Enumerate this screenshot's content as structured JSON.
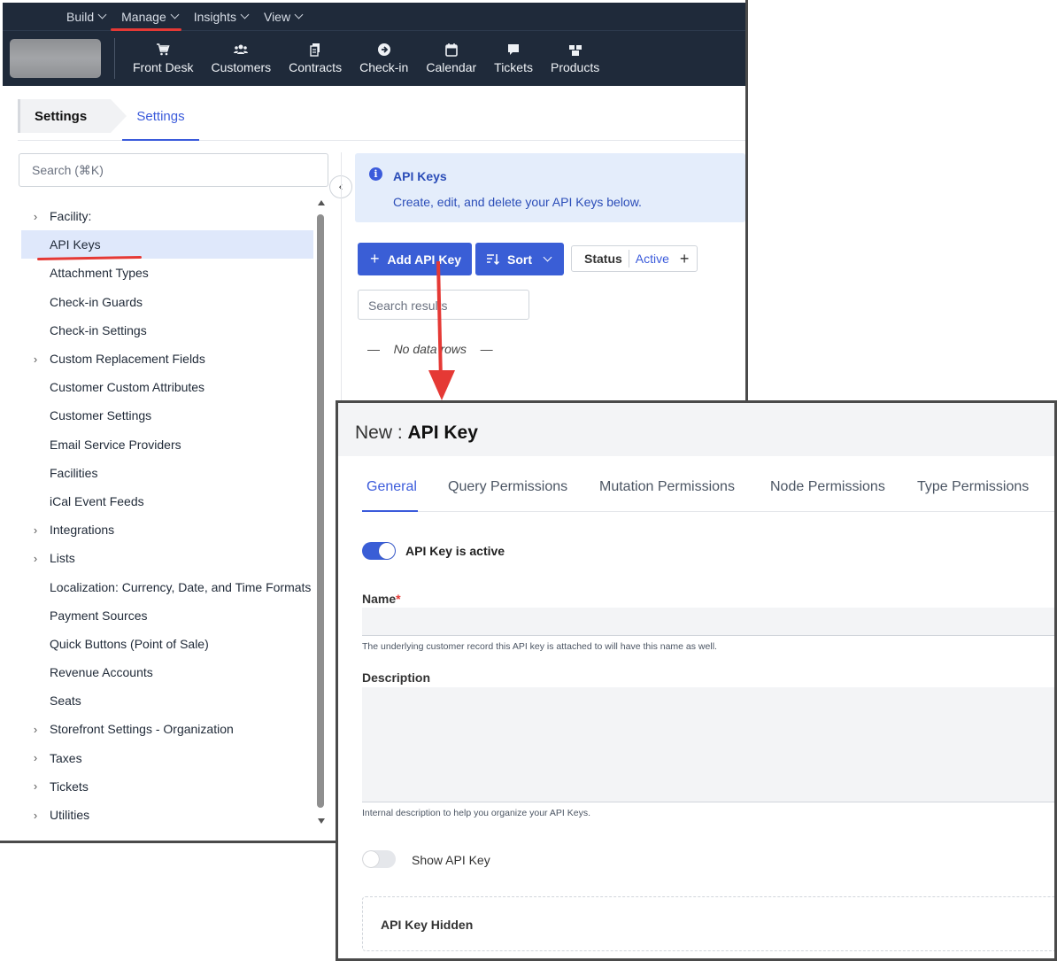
{
  "topmenu": {
    "items": [
      "Build",
      "Manage",
      "Insights",
      "View"
    ]
  },
  "navbar": {
    "items": [
      {
        "label": "Front Desk",
        "icon": "cart-icon"
      },
      {
        "label": "Customers",
        "icon": "users-icon"
      },
      {
        "label": "Contracts",
        "icon": "documents-icon"
      },
      {
        "label": "Check-in",
        "icon": "arrow-circle-icon"
      },
      {
        "label": "Calendar",
        "icon": "calendar-icon"
      },
      {
        "label": "Tickets",
        "icon": "chat-icon"
      },
      {
        "label": "Products",
        "icon": "boxes-icon"
      }
    ]
  },
  "breadcrumb": {
    "root": "Settings",
    "tab": "Settings"
  },
  "sidebar": {
    "search_placeholder": "Search (⌘K)",
    "items": [
      {
        "label": "Facility:",
        "expandable": true
      },
      {
        "label": "API Keys",
        "expandable": false,
        "active": true
      },
      {
        "label": "Attachment Types",
        "expandable": false
      },
      {
        "label": "Check-in Guards",
        "expandable": false
      },
      {
        "label": "Check-in Settings",
        "expandable": false
      },
      {
        "label": "Custom Replacement Fields",
        "expandable": true
      },
      {
        "label": "Customer Custom Attributes",
        "expandable": false
      },
      {
        "label": "Customer Settings",
        "expandable": false
      },
      {
        "label": "Email Service Providers",
        "expandable": false
      },
      {
        "label": "Facilities",
        "expandable": false
      },
      {
        "label": "iCal Event Feeds",
        "expandable": false
      },
      {
        "label": "Integrations",
        "expandable": true
      },
      {
        "label": "Lists",
        "expandable": true
      },
      {
        "label": "Localization: Currency, Date, and Time Formats",
        "expandable": false
      },
      {
        "label": "Payment Sources",
        "expandable": false
      },
      {
        "label": "Quick Buttons (Point of Sale)",
        "expandable": false
      },
      {
        "label": "Revenue Accounts",
        "expandable": false
      },
      {
        "label": "Seats",
        "expandable": false
      },
      {
        "label": "Storefront Settings - Organization",
        "expandable": true
      },
      {
        "label": "Taxes",
        "expandable": true
      },
      {
        "label": "Tickets",
        "expandable": true
      },
      {
        "label": "Utilities",
        "expandable": true
      }
    ]
  },
  "content": {
    "info_title": "API Keys",
    "info_text": "Create, edit, and delete your API Keys below.",
    "add_button": "Add API Key",
    "sort_button": "Sort",
    "status_label": "Status",
    "status_value": "Active",
    "search_placeholder": "Search results",
    "empty_text": "No data rows",
    "empty_dash": "—"
  },
  "dialog": {
    "title_prefix": "New : ",
    "title_main": "API Key",
    "tabs": [
      "General",
      "Query Permissions",
      "Mutation Permissions",
      "Node Permissions",
      "Type Permissions"
    ],
    "active_toggle_label": "API Key is active",
    "active_toggle_on": true,
    "name_label": "Name",
    "name_required": "*",
    "name_value": "",
    "name_help": "The underlying customer record this API key is attached to will have this name as well.",
    "description_label": "Description",
    "description_value": "",
    "description_help": "Internal description to help you organize your API Keys.",
    "show_toggle_label": "Show API Key",
    "show_toggle_on": false,
    "hidden_label": "API Key Hidden"
  },
  "colors": {
    "nav_bg": "#1f2a3a",
    "accent": "#3a5ed6",
    "annotation_red": "#e53935",
    "active_row": "#dfe8fb"
  }
}
